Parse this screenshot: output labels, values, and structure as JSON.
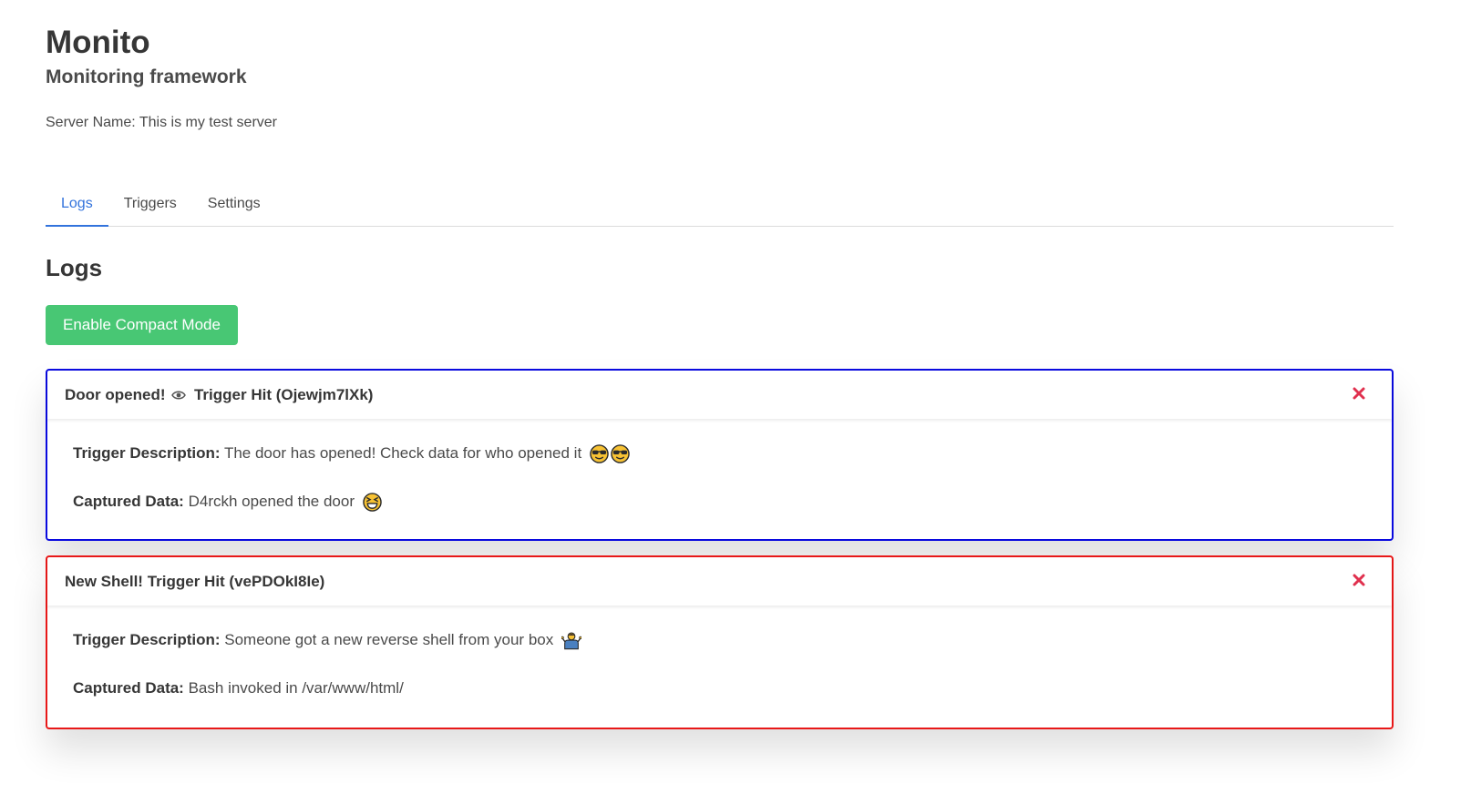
{
  "header": {
    "title": "Monito",
    "subtitle": "Monitoring framework",
    "server_label": "Server Name:",
    "server_name": "This is my test server"
  },
  "tabs": [
    {
      "label": "Logs",
      "active": true
    },
    {
      "label": "Triggers",
      "active": false
    },
    {
      "label": "Settings",
      "active": false
    }
  ],
  "logs_section": {
    "title": "Logs",
    "compact_button_label": "Enable Compact Mode"
  },
  "logs": [
    {
      "title_prefix": "Door opened!",
      "title_icon": "eye-icon",
      "title_suffix": "Trigger Hit (Ojewjm7lXk)",
      "border_color": "#0a0adf",
      "description_label": "Trigger Description:",
      "description": "The door has opened! Check data for who opened it",
      "description_emojis": [
        "sunglasses-face-icon",
        "sunglasses-face-icon"
      ],
      "data_label": "Captured Data:",
      "data": "D4rckh opened the door",
      "data_emoji": "grinning-squinting-face-icon"
    },
    {
      "title_prefix": "New Shell!",
      "title_suffix": "Trigger Hit (vePDOkI8Ie)",
      "border_color": "#e81818",
      "description_label": "Trigger Description:",
      "description": "Someone got a new reverse shell from your box",
      "description_emojis": [
        "person-shrugging-icon"
      ],
      "data_label": "Captured Data:",
      "data": "Bash invoked in /var/www/html/"
    }
  ],
  "colors": {
    "accent": "#3273dc",
    "button_green": "#48c774",
    "close_red": "#e0304e"
  }
}
